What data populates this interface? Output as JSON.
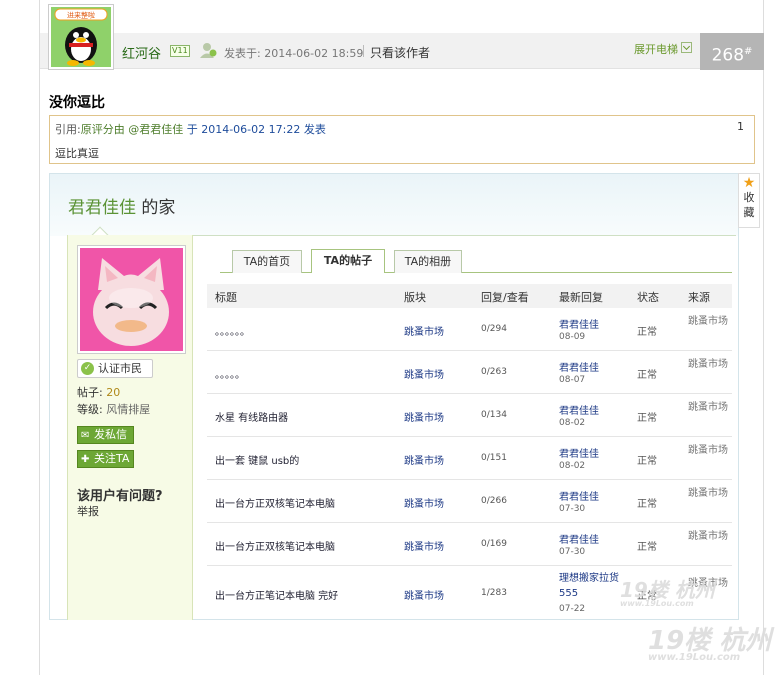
{
  "post": {
    "username": "红河谷",
    "level_badge": "11",
    "posted_at": "发表于: 2014-06-02 18:59",
    "only_author": "只看该作者",
    "expand": "展开电梯",
    "floor_number": "268",
    "floor_mark": "#",
    "title": "没你逗比",
    "avatar_badge": "进来整啦"
  },
  "quote": {
    "prefix": "引用:",
    "original_by": "原评分由",
    "at_user": "@君君佳佳",
    "at_word": "于",
    "date": "2014-06-02 17:22",
    "published": "发表",
    "index": "1",
    "text": "逗比真逗"
  },
  "home": {
    "owner": "君君佳佳",
    "suffix": "的家",
    "favorite": "收藏",
    "certified": "认证市民",
    "posts_label": "帖子:",
    "posts_value": "20",
    "level_label": "等级:",
    "level_value": "风情排屋",
    "pm_button": "发私信",
    "follow_button": "关注TA",
    "problem_heading": "该用户有问题?",
    "report_link": "举报"
  },
  "tabs": [
    {
      "label": "TA的首页",
      "active": false
    },
    {
      "label": "TA的帖子",
      "active": true
    },
    {
      "label": "TA的相册",
      "active": false
    }
  ],
  "table": {
    "headers": {
      "title": "标题",
      "board": "版块",
      "counts": "回复/查看",
      "last": "最新回复",
      "status": "状态",
      "source": "来源"
    },
    "rows": [
      {
        "title": "。。。。。。",
        "board": "跳蚤市场",
        "counts": "0/294",
        "last_user": "君君佳佳",
        "last_date": "08-09",
        "status": "正常",
        "source": "跳蚤市场"
      },
      {
        "title": "。。。。。",
        "board": "跳蚤市场",
        "counts": "0/263",
        "last_user": "君君佳佳",
        "last_date": "08-07",
        "status": "正常",
        "source": "跳蚤市场"
      },
      {
        "title": "水星 有线路由器",
        "board": "跳蚤市场",
        "counts": "0/134",
        "last_user": "君君佳佳",
        "last_date": "08-02",
        "status": "正常",
        "source": "跳蚤市场"
      },
      {
        "title": "出一套 键鼠 usb的",
        "board": "跳蚤市场",
        "counts": "0/151",
        "last_user": "君君佳佳",
        "last_date": "08-02",
        "status": "正常",
        "source": "跳蚤市场"
      },
      {
        "title": "出一台方正双核笔记本电脑",
        "board": "跳蚤市场",
        "counts": "0/266",
        "last_user": "君君佳佳",
        "last_date": "07-30",
        "status": "正常",
        "source": "跳蚤市场"
      },
      {
        "title": "出一台方正双核笔记本电脑",
        "board": "跳蚤市场",
        "counts": "0/169",
        "last_user": "君君佳佳",
        "last_date": "07-30",
        "status": "正常",
        "source": "跳蚤市场"
      },
      {
        "title": "出一台方正笔记本电脑 完好",
        "board": "跳蚤市场",
        "counts": "1/283",
        "last_user": "理想搬家拉货555",
        "last_date": "07-22",
        "status": "正常",
        "source": "跳蚤市场"
      }
    ]
  },
  "watermark": {
    "brand": "19楼",
    "city": "杭州",
    "url": "www.19Lou.com"
  }
}
